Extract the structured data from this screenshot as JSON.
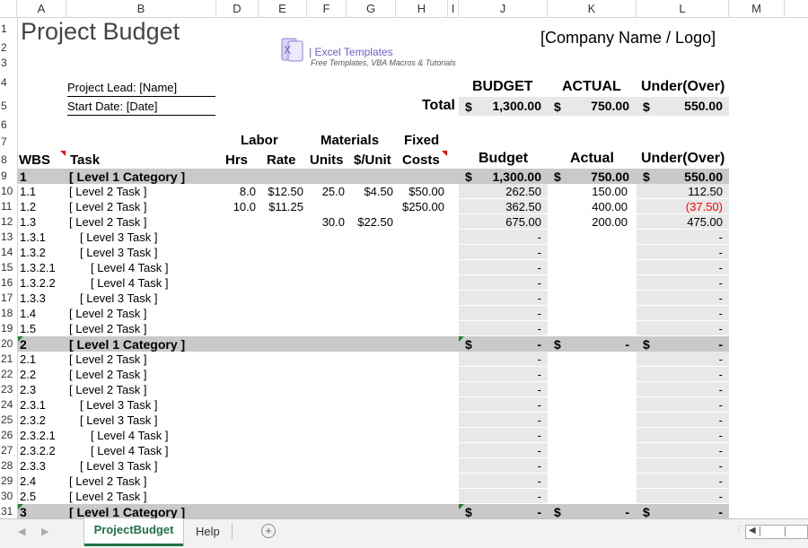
{
  "columns": [
    "A",
    "B",
    "D",
    "E",
    "F",
    "G",
    "H",
    "I",
    "J",
    "K",
    "L",
    "M"
  ],
  "rows": [
    "1",
    "2",
    "3",
    "4",
    "5",
    "6",
    "7",
    "8",
    "9",
    "10",
    "11",
    "12",
    "13",
    "14",
    "15",
    "16",
    "17",
    "18",
    "19",
    "20",
    "21",
    "22",
    "23",
    "24",
    "25",
    "26",
    "27",
    "28",
    "29",
    "30",
    "31"
  ],
  "title": "Project Budget",
  "company": "[Company Name / Logo]",
  "logo": {
    "brand": "| Excel Templates",
    "tagline": "Free Templates, VBA Macros & Tutorials"
  },
  "project_lead": "Project Lead: [Name]",
  "start_date": "Start Date: [Date]",
  "summary": {
    "h_budget": "BUDGET",
    "h_actual": "ACTUAL",
    "h_under": "Under(Over)",
    "total_label": "Total",
    "cur": "$",
    "budget": "1,300.00",
    "actual": "750.00",
    "under": "550.00"
  },
  "headers": {
    "labor": "Labor",
    "materials": "Materials",
    "fixed": "Fixed",
    "wbs": "WBS",
    "task": "Task",
    "hrs": "Hrs",
    "rate": "Rate",
    "units": "Units",
    "unit_cost": "$/Unit",
    "costs": "Costs",
    "budget": "Budget",
    "actual": "Actual",
    "under": "Under(Over)"
  },
  "tasks": [
    {
      "wbs": "1",
      "task": "[ Level 1 Category ]",
      "cat": true,
      "budget": "1,300.00",
      "actual": "750.00",
      "under": "550.00"
    },
    {
      "wbs": "1.1",
      "task": "[ Level 2 Task ]",
      "hrs": "8.0",
      "rate": "$12.50",
      "units": "25.0",
      "unit": "$4.50",
      "fixed": "$50.00",
      "budget": "262.50",
      "actual": "150.00",
      "under": "112.50"
    },
    {
      "wbs": "1.2",
      "task": "[ Level 2 Task ]",
      "hrs": "10.0",
      "rate": "$11.25",
      "fixed": "$250.00",
      "budget": "362.50",
      "actual": "400.00",
      "under": "(37.50)",
      "neg": true
    },
    {
      "wbs": "1.3",
      "task": "[ Level 2 Task ]",
      "units": "30.0",
      "unit": "$22.50",
      "budget": "675.00",
      "actual": "200.00",
      "under": "475.00"
    },
    {
      "wbs": "1.3.1",
      "task": "[ Level 3 Task ]",
      "indent": 1,
      "budget": "-",
      "under": "-"
    },
    {
      "wbs": "1.3.2",
      "task": "[ Level 3 Task ]",
      "indent": 1,
      "budget": "-",
      "under": "-"
    },
    {
      "wbs": "1.3.2.1",
      "task": "[ Level 4 Task ]",
      "indent": 2,
      "budget": "-",
      "under": "-"
    },
    {
      "wbs": "1.3.2.2",
      "task": "[ Level 4 Task ]",
      "indent": 2,
      "budget": "-",
      "under": "-"
    },
    {
      "wbs": "1.3.3",
      "task": "[ Level 3 Task ]",
      "indent": 1,
      "budget": "-",
      "under": "-"
    },
    {
      "wbs": "1.4",
      "task": "[ Level 2 Task ]",
      "budget": "-",
      "under": "-"
    },
    {
      "wbs": "1.5",
      "task": "[ Level 2 Task ]",
      "budget": "-",
      "under": "-"
    },
    {
      "wbs": "2",
      "task": "[ Level 1 Category ]",
      "cat": true,
      "budget": "-",
      "actual": "-",
      "under": "-"
    },
    {
      "wbs": "2.1",
      "task": "[ Level 2 Task ]",
      "budget": "-",
      "under": "-"
    },
    {
      "wbs": "2.2",
      "task": "[ Level 2 Task ]",
      "budget": "-",
      "under": "-"
    },
    {
      "wbs": "2.3",
      "task": "[ Level 2 Task ]",
      "budget": "-",
      "under": "-"
    },
    {
      "wbs": "2.3.1",
      "task": "[ Level 3 Task ]",
      "indent": 1,
      "budget": "-",
      "under": "-"
    },
    {
      "wbs": "2.3.2",
      "task": "[ Level 3 Task ]",
      "indent": 1,
      "budget": "-",
      "under": "-"
    },
    {
      "wbs": "2.3.2.1",
      "task": "[ Level 4 Task ]",
      "indent": 2,
      "budget": "-",
      "under": "-"
    },
    {
      "wbs": "2.3.2.2",
      "task": "[ Level 4 Task ]",
      "indent": 2,
      "budget": "-",
      "under": "-"
    },
    {
      "wbs": "2.3.3",
      "task": "[ Level 3 Task ]",
      "indent": 1,
      "budget": "-",
      "under": "-"
    },
    {
      "wbs": "2.4",
      "task": "[ Level 2 Task ]",
      "budget": "-",
      "under": "-"
    },
    {
      "wbs": "2.5",
      "task": "[ Level 2 Task ]",
      "budget": "-",
      "under": "-"
    },
    {
      "wbs": "3",
      "task": "[ Level 1 Category ]",
      "cat": true,
      "budget": "-",
      "actual": "-",
      "under": "-"
    }
  ],
  "sheet_tabs": {
    "active": "ProjectBudget",
    "other": "Help",
    "add": "+"
  },
  "colors": {
    "active_tab": "#217346",
    "negative": "#ff0000",
    "category_fill": "#c9c9c9",
    "calc_fill": "#e8e8e8",
    "excel_green": "#1e7d32"
  }
}
